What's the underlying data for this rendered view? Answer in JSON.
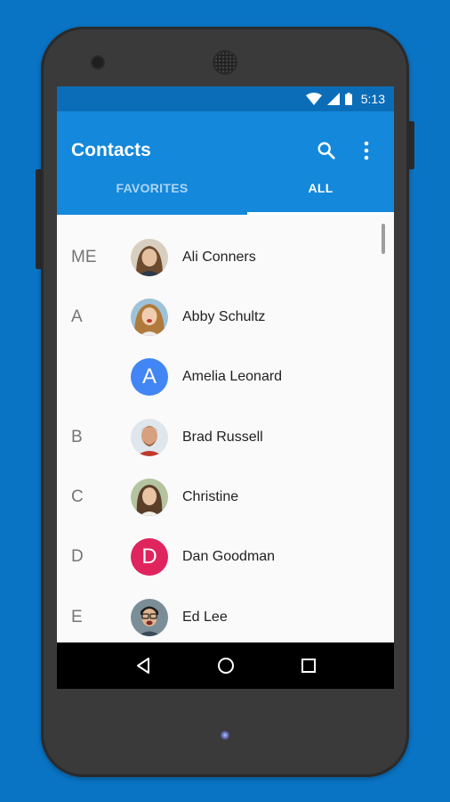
{
  "status_bar": {
    "time": "5:13"
  },
  "app_bar": {
    "title": "Contacts"
  },
  "tabs": [
    {
      "label": "FAVORITES",
      "active": false
    },
    {
      "label": "ALL",
      "active": true
    }
  ],
  "contacts": [
    {
      "section": "ME",
      "name": "Ali Conners",
      "avatar_type": "photo",
      "avatar_color": "#c9a27d"
    },
    {
      "section": "A",
      "name": "Abby Schultz",
      "avatar_type": "photo",
      "avatar_color": "#a3743f"
    },
    {
      "section": "",
      "name": "Amelia Leonard",
      "avatar_type": "letter",
      "avatar_letter": "A",
      "avatar_color": "#4285f4"
    },
    {
      "section": "B",
      "name": "Brad Russell",
      "avatar_type": "photo",
      "avatar_color": "#b37a5c"
    },
    {
      "section": "C",
      "name": "Christine",
      "avatar_type": "photo",
      "avatar_color": "#8a9a7a"
    },
    {
      "section": "D",
      "name": "Dan Goodman",
      "avatar_type": "letter",
      "avatar_letter": "D",
      "avatar_color": "#e0245e"
    },
    {
      "section": "E",
      "name": "Ed Lee",
      "avatar_type": "photo",
      "avatar_color": "#6b7f8a"
    }
  ],
  "colors": {
    "primary": "#1488db",
    "primary_dark": "#0b6db8",
    "background": "#0a74c4"
  },
  "icons": {
    "search": "search-icon",
    "more": "more-vert-icon",
    "fab": "add-contact-icon",
    "back": "back-icon",
    "home": "home-icon",
    "recents": "recents-icon"
  }
}
